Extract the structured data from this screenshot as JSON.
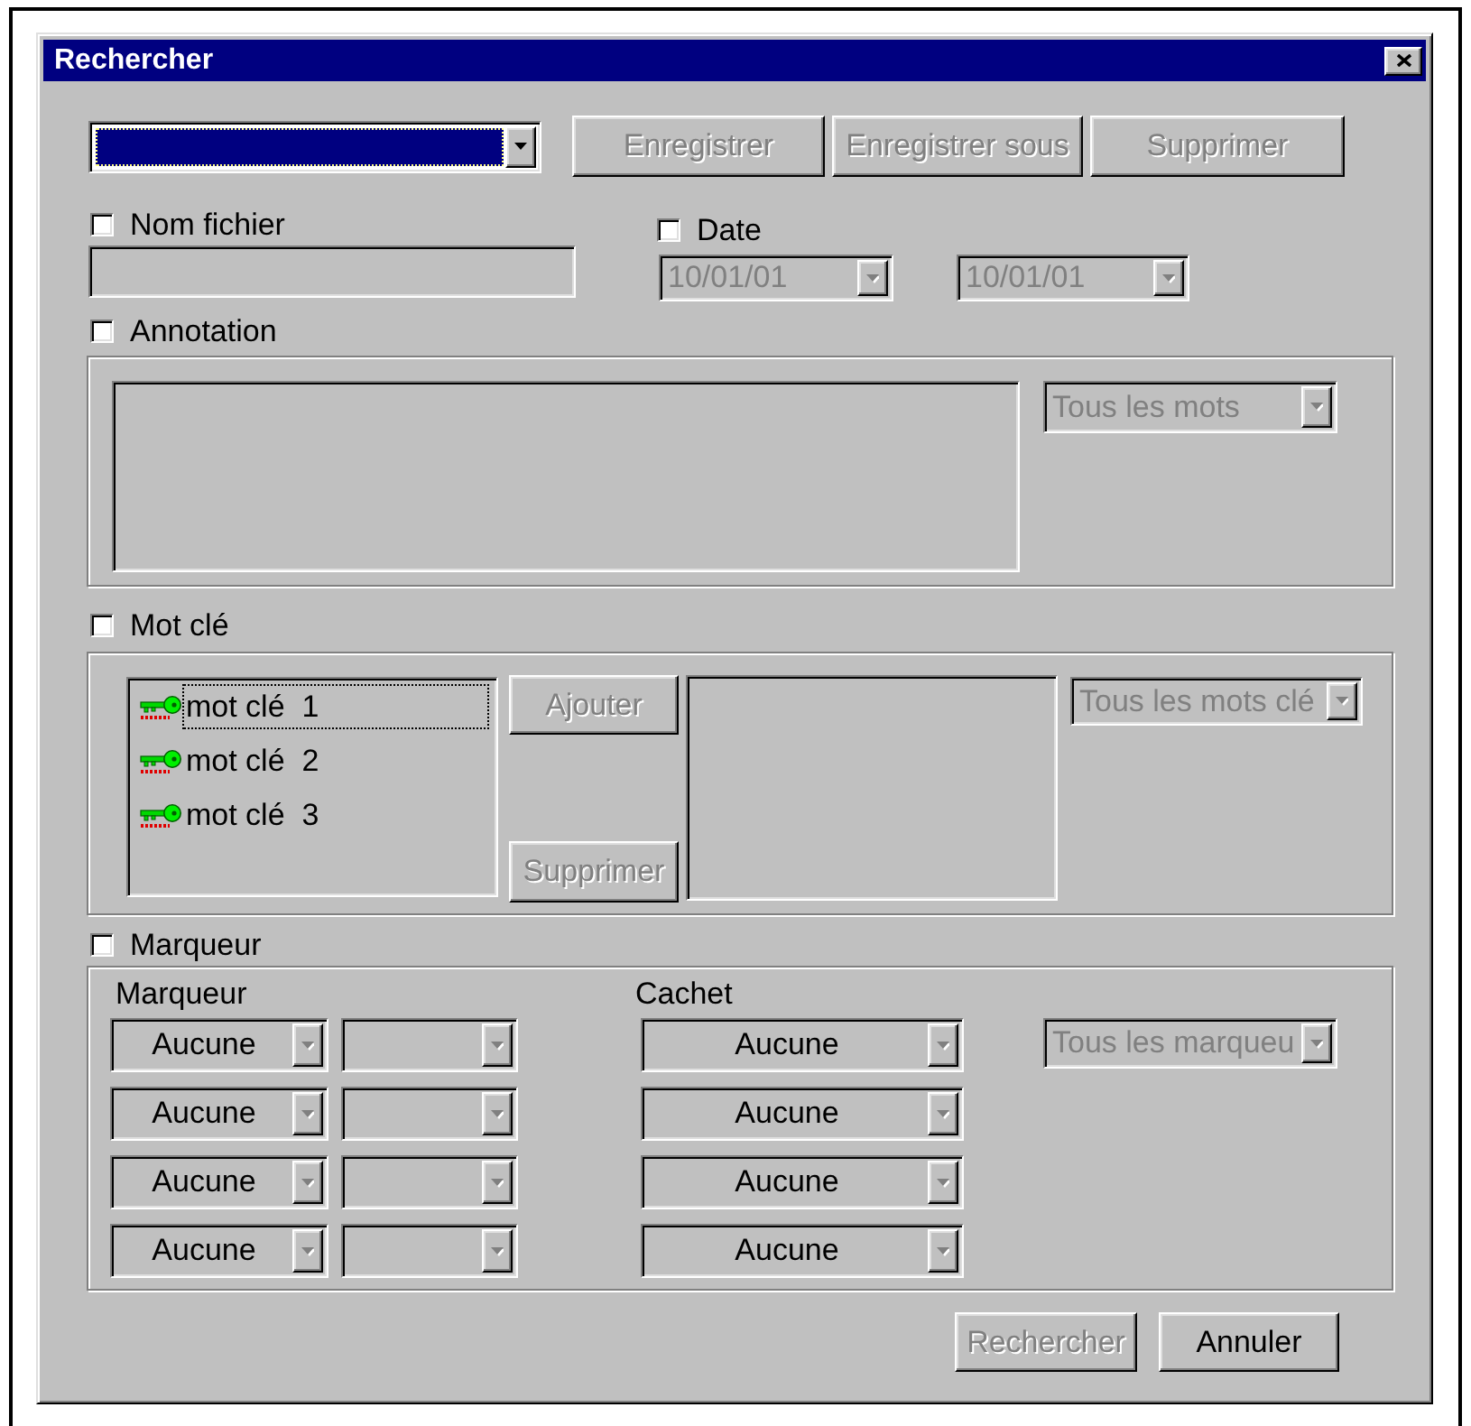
{
  "window": {
    "title": "Rechercher"
  },
  "saved_search": {
    "focused": true
  },
  "toolbar_buttons": [
    {
      "label": "Enregistrer",
      "disabled": true
    },
    {
      "label": "Enregistrer sous",
      "disabled": true
    },
    {
      "label": "Supprimer",
      "disabled": true
    }
  ],
  "file_name": {
    "label": "Nom fichier",
    "checked": false,
    "field": {
      "disabled": true
    }
  },
  "date": {
    "label": "Date",
    "checked": false,
    "from": {
      "value": "10/01/01",
      "disabled": true
    },
    "to": {
      "value": "10/01/01",
      "disabled": true
    }
  },
  "annotation": {
    "label": "Annotation",
    "checked": false,
    "match": {
      "value": "Tous les mots",
      "disabled": true
    }
  },
  "keyword": {
    "label": "Mot clé",
    "checked": false,
    "items": [
      {
        "label": "mot clé  1",
        "focused": true
      },
      {
        "label": "mot clé  2",
        "focused": false
      },
      {
        "label": "mot clé  3",
        "focused": false
      }
    ],
    "add_button": {
      "label": "Ajouter",
      "disabled": true
    },
    "remove_button": {
      "label": "Supprimer",
      "disabled": true
    },
    "match": {
      "value": "Tous les mots clé",
      "disabled": true
    }
  },
  "marker": {
    "label": "Marqueur",
    "checked": false,
    "marker_heading": "Marqueur",
    "stamp_heading": "Cachet",
    "rows": [
      {
        "marker": "Aucune",
        "stamp": "Aucune"
      },
      {
        "marker": "Aucune",
        "stamp": "Aucune"
      },
      {
        "marker": "Aucune",
        "stamp": "Aucune"
      },
      {
        "marker": "Aucune",
        "stamp": "Aucune"
      }
    ],
    "match": {
      "value": "Tous les marqueu",
      "disabled": true
    }
  },
  "footer_buttons": [
    {
      "label": "Rechercher",
      "disabled": true
    },
    {
      "label": "Annuler",
      "disabled": false
    }
  ]
}
